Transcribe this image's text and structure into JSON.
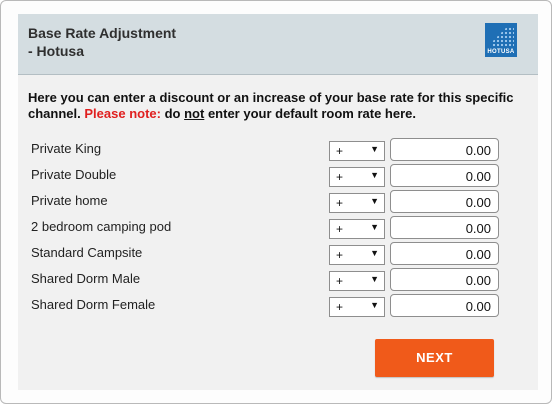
{
  "header": {
    "title_line1": "Base Rate Adjustment",
    "title_line2": "- Hotusa",
    "logo_text": "HOTUSA"
  },
  "intro": {
    "text": "Here you can enter a discount or an increase of your base rate for this specific channel.",
    "note_label": "Please note:",
    "note_pre": "do",
    "note_emphasis": "not",
    "note_post": "enter your default room rate here."
  },
  "rooms": [
    {
      "name": "Private King",
      "sign": "+",
      "rate": "0.00"
    },
    {
      "name": "Private Double",
      "sign": "+",
      "rate": "0.00"
    },
    {
      "name": "Private home",
      "sign": "+",
      "rate": "0.00"
    },
    {
      "name": "2 bedroom camping pod",
      "sign": "+",
      "rate": "0.00"
    },
    {
      "name": "Standard Campsite",
      "sign": "+",
      "rate": "0.00"
    },
    {
      "name": "Shared Dorm Male",
      "sign": "+",
      "rate": "0.00"
    },
    {
      "name": "Shared Dorm Female",
      "sign": "+",
      "rate": "0.00"
    }
  ],
  "actions": {
    "next_label": "NEXT"
  },
  "colors": {
    "header_bg": "#d4dde1",
    "note_red": "#e02020",
    "next_orange": "#f05a1a",
    "logo_blue": "#1f6fb5"
  }
}
